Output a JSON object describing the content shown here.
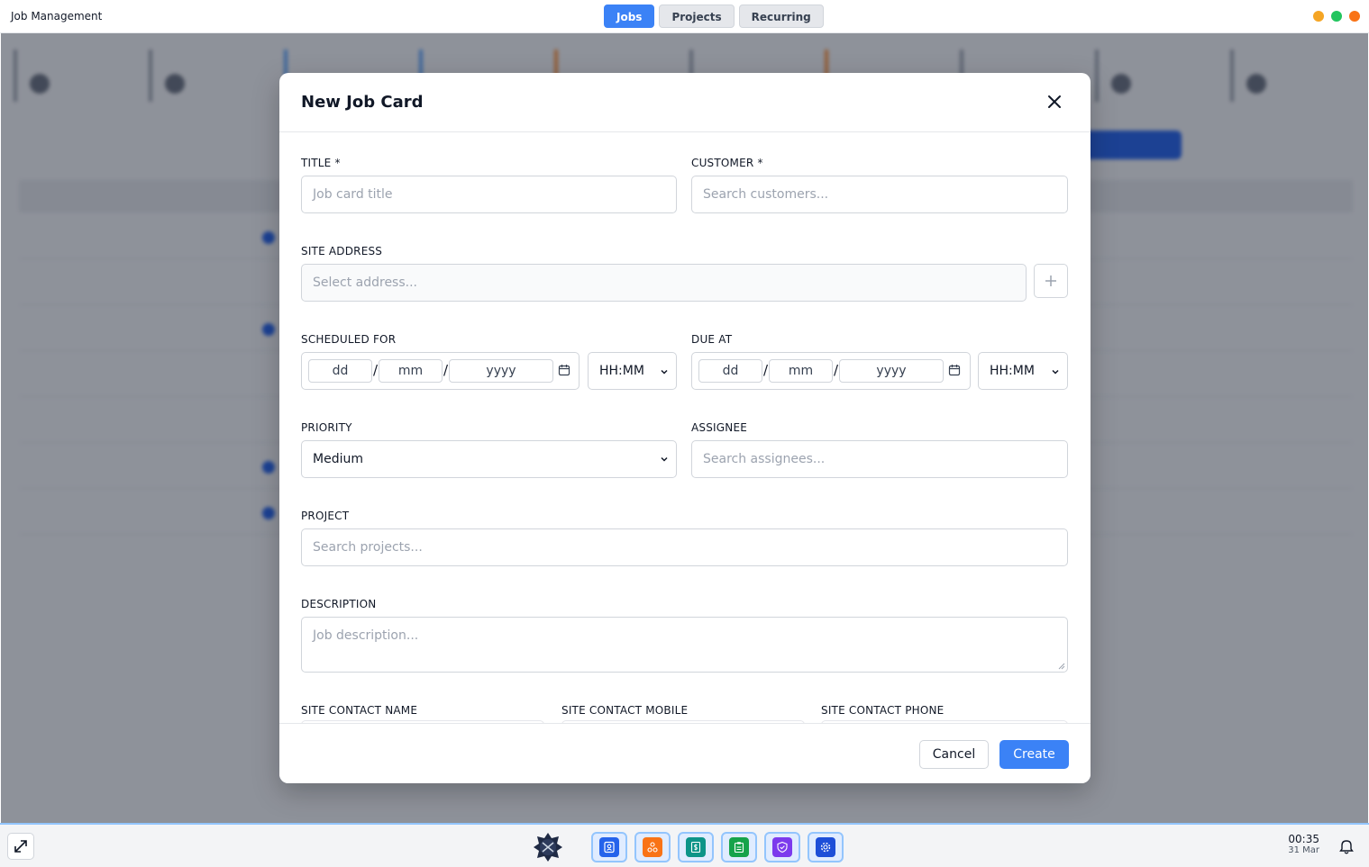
{
  "app": {
    "title": "Job Management"
  },
  "tabs": [
    {
      "label": "Jobs",
      "active": true
    },
    {
      "label": "Projects",
      "active": false
    },
    {
      "label": "Recurring",
      "active": false
    }
  ],
  "modal": {
    "title": "New Job Card",
    "title_field": {
      "label": "TITLE *",
      "placeholder": "Job card title"
    },
    "customer_field": {
      "label": "CUSTOMER *",
      "placeholder": "Search customers..."
    },
    "site_address_field": {
      "label": "SITE ADDRESS",
      "placeholder": "Select address..."
    },
    "scheduled_for": {
      "label": "SCHEDULED FOR",
      "dd": "dd",
      "mm": "mm",
      "yyyy": "yyyy",
      "sep": "/",
      "time": "HH:MM"
    },
    "due_at": {
      "label": "DUE AT",
      "dd": "dd",
      "mm": "mm",
      "yyyy": "yyyy",
      "sep": "/",
      "time": "HH:MM"
    },
    "priority_field": {
      "label": "PRIORITY",
      "value": "Medium"
    },
    "assignee_field": {
      "label": "ASSIGNEE",
      "placeholder": "Search assignees..."
    },
    "project_field": {
      "label": "PROJECT",
      "placeholder": "Search projects..."
    },
    "description_field": {
      "label": "DESCRIPTION",
      "placeholder": "Job description..."
    },
    "site_contact_name": {
      "label": "SITE CONTACT NAME"
    },
    "site_contact_mobile": {
      "label": "SITE CONTACT MOBILE"
    },
    "site_contact_phone": {
      "label": "SITE CONTACT PHONE"
    },
    "cancel_label": "Cancel",
    "create_label": "Create"
  },
  "taskbar": {
    "time": "00:35",
    "date": "31 Mar",
    "apps": [
      "contacts-icon",
      "network-icon",
      "invoice-icon",
      "clipboard-icon",
      "shield-icon",
      "settings-icon"
    ]
  },
  "colors": {
    "accent": "#3b82f6",
    "overlay": "rgba(17,24,39,0.45)"
  }
}
